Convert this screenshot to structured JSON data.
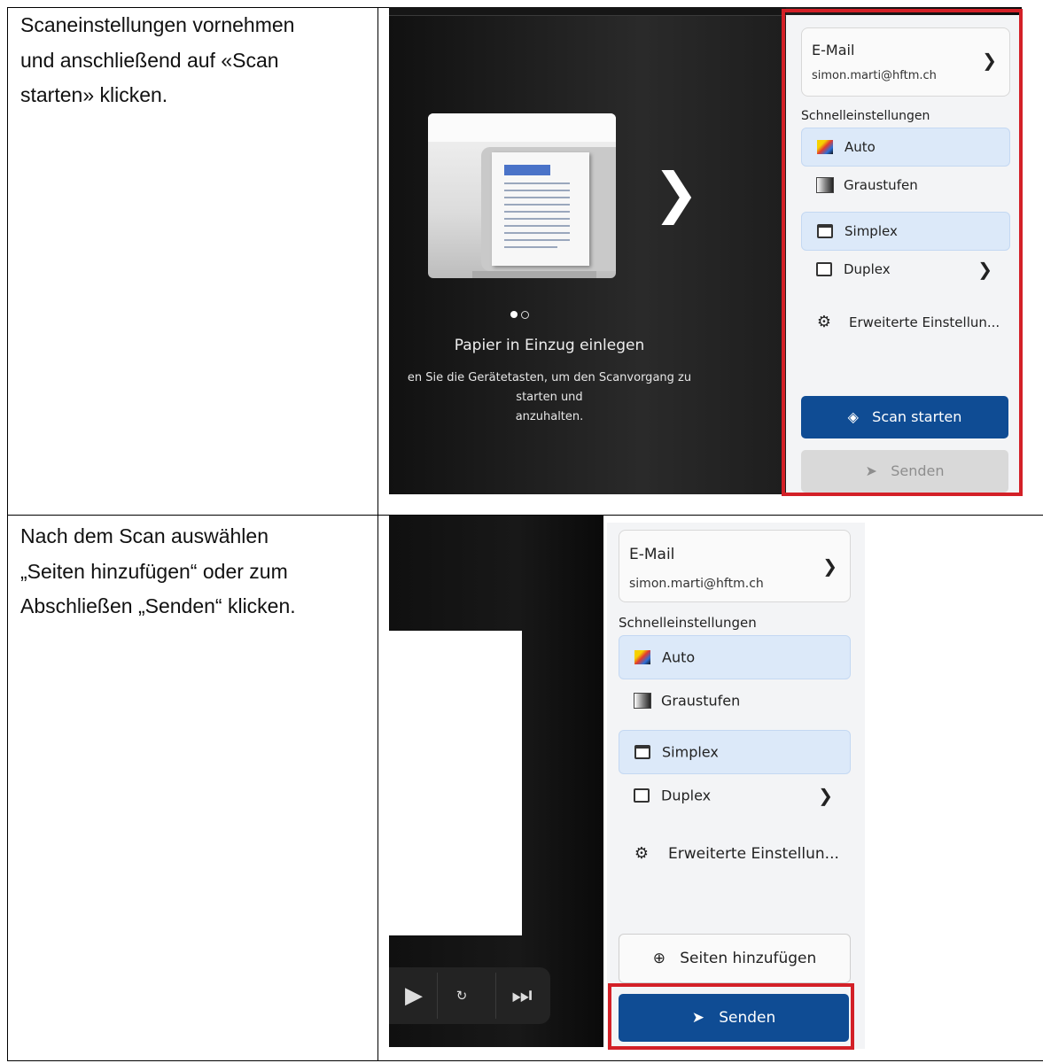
{
  "instructions": {
    "step1": [
      "Scaneinstellungen vornehmen",
      "und anschließend auf «Scan",
      "starten» klicken."
    ],
    "step2": [
      "Nach dem Scan auswählen",
      "„Seiten hinzufügen“ oder zum",
      "Abschließen „Senden“ klicken."
    ]
  },
  "screen1": {
    "pager_dots": 2,
    "instruction_title": "Papier in Einzug einlegen",
    "instruction_text_1": "en Sie die Gerätetasten, um den Scanvorgang zu starten und",
    "instruction_text_2": "anzuhalten.",
    "panel": {
      "destination_label": "E-Mail",
      "destination_value": "simon.marti@hftm.ch",
      "quick_settings_title": "Schnelleinstellungen",
      "color_options": [
        {
          "label": "Auto",
          "selected": true,
          "icon": "color-icon"
        },
        {
          "label": "Graustufen",
          "selected": false,
          "icon": "grayscale-icon"
        }
      ],
      "side_options": [
        {
          "label": "Simplex",
          "selected": true,
          "icon": "simplex-icon"
        },
        {
          "label": "Duplex",
          "selected": false,
          "icon": "duplex-icon"
        }
      ],
      "advanced_label": "Erweiterte Einstellun...",
      "scan_button": "Scan starten",
      "send_button": "Senden"
    }
  },
  "screen2": {
    "panel": {
      "destination_label": "E-Mail",
      "destination_value": "simon.marti@hftm.ch",
      "quick_settings_title": "Schnelleinstellungen",
      "color_options": [
        {
          "label": "Auto",
          "selected": true,
          "icon": "color-icon"
        },
        {
          "label": "Graustufen",
          "selected": false,
          "icon": "grayscale-icon"
        }
      ],
      "side_options": [
        {
          "label": "Simplex",
          "selected": true,
          "icon": "simplex-icon"
        },
        {
          "label": "Duplex",
          "selected": false,
          "icon": "duplex-icon"
        }
      ],
      "advanced_label": "Erweiterte Einstellun...",
      "add_pages_button": "Seiten hinzufügen",
      "send_button": "Senden"
    },
    "player_controls": [
      "play-icon",
      "skip-forward-10-icon",
      "skip-to-end-icon"
    ]
  },
  "colors": {
    "highlight": "#d32027",
    "primary_button": "#0f4c94",
    "selected_option": "#dce9f9"
  }
}
